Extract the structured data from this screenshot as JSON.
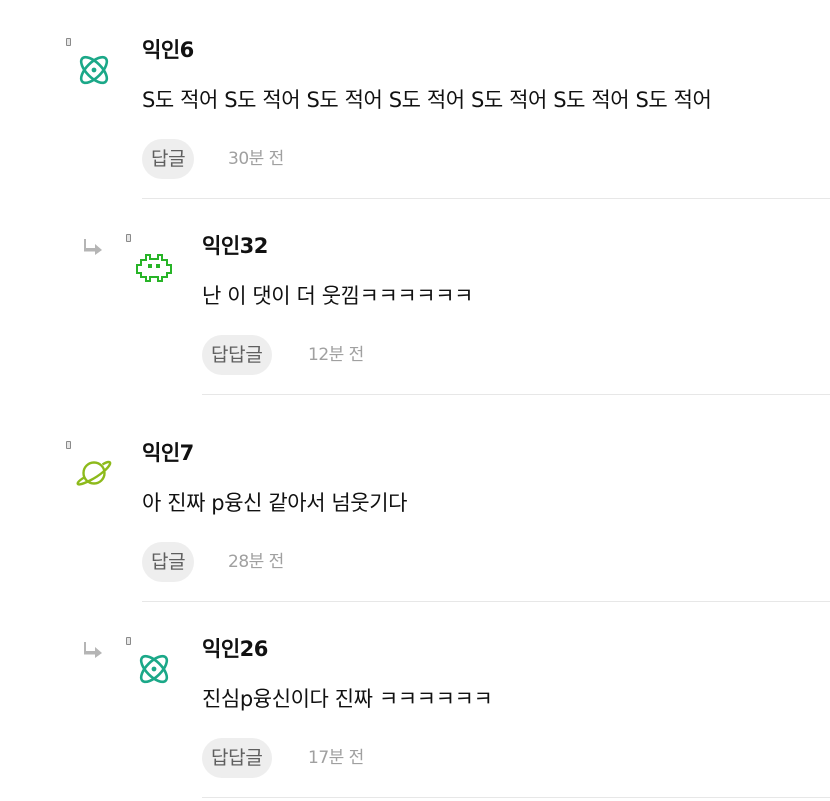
{
  "comments": [
    {
      "kind": "top",
      "author": "익인6",
      "avatar_icon": "atom-icon",
      "avatar_color": "#1ba888",
      "text": "S도 적어 S도 적어 S도 적어 S도 적어 S도 적어 S도 적어 S도 적어",
      "reply_label": "답글",
      "time": "30분 전"
    },
    {
      "kind": "reply",
      "author": "익인32",
      "avatar_icon": "space-invader-icon",
      "avatar_color": "#28b428",
      "text": "난 이 댓이 더 웃낌ㅋㅋㅋㅋㅋㅋ",
      "reply_label": "답답글",
      "time": "12분 전"
    },
    {
      "kind": "top",
      "author": "익인7",
      "avatar_icon": "planet-icon",
      "avatar_color": "#8dba1b",
      "text": "아 진짜 p융신 같아서 넘웃기다",
      "reply_label": "답글",
      "time": "28분 전"
    },
    {
      "kind": "reply",
      "author": "익인26",
      "avatar_icon": "atom-icon",
      "avatar_color": "#1ba888",
      "text": "진심p융신이다 진짜 ㅋㅋㅋㅋㅋㅋ",
      "reply_label": "답답글",
      "time": "17분 전"
    }
  ],
  "colors": {
    "reply_arrow": "#b5b5b5",
    "reply_button_bg": "#eeeeee",
    "reply_button_text": "#5f5f5f",
    "timestamp": "#a0a0a0",
    "divider": "#e7e7e7"
  }
}
